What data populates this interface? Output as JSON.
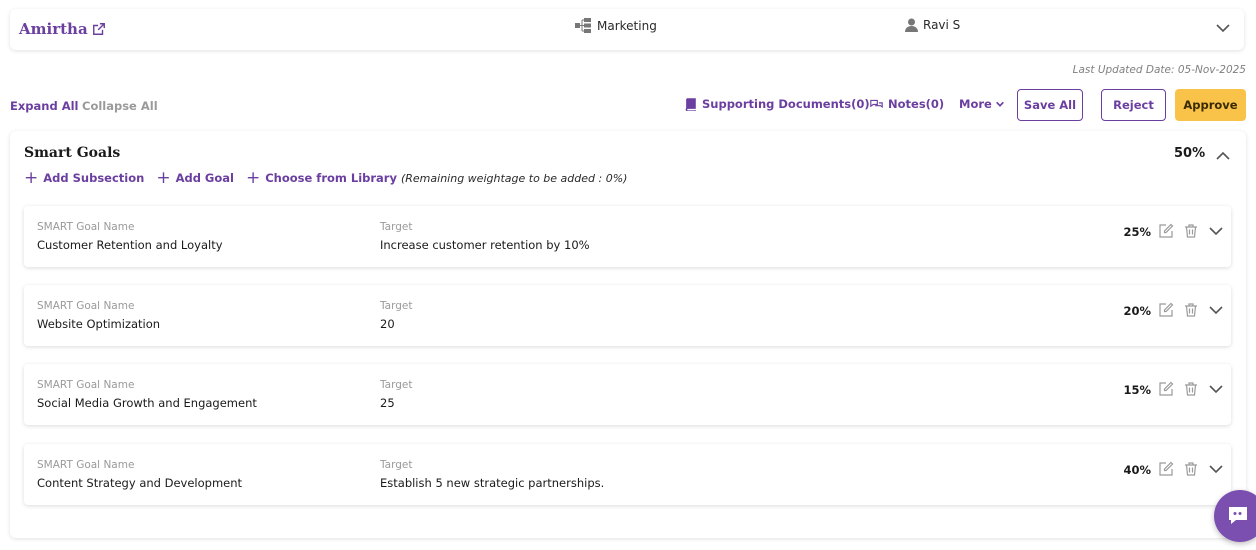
{
  "header": {
    "employee_name": "Amirtha",
    "department": "Marketing",
    "manager": "Ravi S"
  },
  "last_updated": "Last Updated Date: 05-Nov-2025",
  "toolbar": {
    "expand_all": "Expand All",
    "collapse_all": "Collapse All",
    "supporting_documents": "Supporting Documents(0)",
    "notes": "Notes(0)",
    "more": "More",
    "save_all": "Save All",
    "reject": "Reject",
    "approve": "Approve"
  },
  "section": {
    "title": "Smart Goals",
    "weightage": "50%",
    "add_subsection": "Add Subsection",
    "add_goal": "Add Goal",
    "choose_library": "Choose from Library",
    "remaining": "(Remaining weightage to be added : 0%)",
    "goals": [
      {
        "name_label": "SMART Goal Name",
        "name": "Customer Retention and Loyalty",
        "target_label": "Target",
        "target": "Increase customer retention by 10%",
        "weight": "25%"
      },
      {
        "name_label": "SMART Goal Name",
        "name": "Website Optimization",
        "target_label": "Target",
        "target": "20",
        "weight": "20%"
      },
      {
        "name_label": "SMART Goal Name",
        "name": "Social Media Growth and Engagement",
        "target_label": "Target",
        "target": "25",
        "weight": "15%"
      },
      {
        "name_label": "SMART Goal Name",
        "name": "Content Strategy and Development",
        "target_label": "Target",
        "target": "Establish 5 new strategic partnerships.",
        "weight": "40%"
      }
    ]
  },
  "colors": {
    "accent": "#6b3fa0",
    "approve": "#f9c349",
    "muted": "#9a9a9a"
  },
  "icons": [
    "external-link-icon",
    "org-chart-icon",
    "user-icon",
    "chevron-down-icon",
    "book-icon",
    "chat-bubbles-icon",
    "plus-icon",
    "edit-icon",
    "trash-icon",
    "chevron-up-icon",
    "chat-support-icon"
  ]
}
